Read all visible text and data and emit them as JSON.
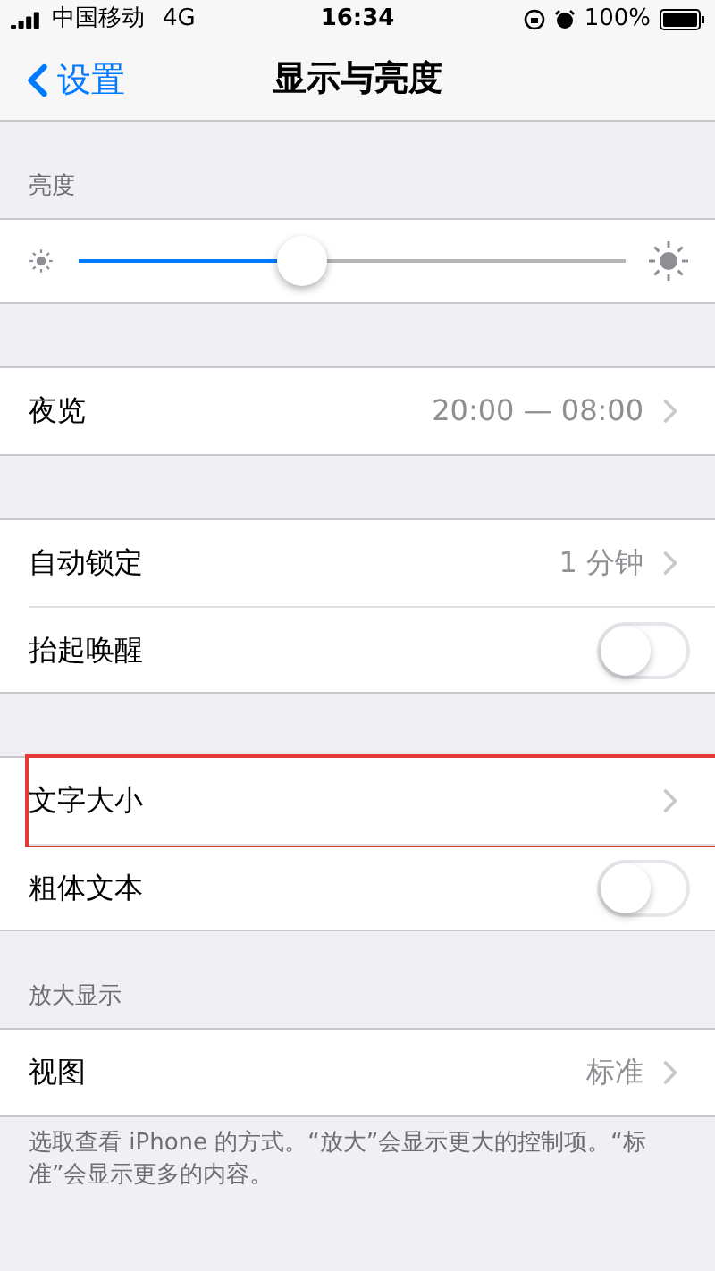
{
  "status_bar": {
    "carrier": "中国移动",
    "network": "4G",
    "time": "16:34",
    "battery": "100%"
  },
  "nav": {
    "back": "设置",
    "title": "显示与亮度"
  },
  "sections": [
    {
      "header": "亮度",
      "kind": "slider",
      "level": 0.41
    },
    {
      "kind": "list",
      "rows": [
        {
          "kind": "value",
          "label": "夜览",
          "value": "20:00 — 08:00",
          "highlighted": false
        }
      ]
    },
    {
      "kind": "list",
      "rows": [
        {
          "kind": "value",
          "label": "自动锁定",
          "value": "1 分钟",
          "highlighted": false
        },
        {
          "kind": "toggle",
          "label": "抬起唤醒",
          "on": false,
          "highlighted": false
        }
      ]
    },
    {
      "kind": "list",
      "rows": [
        {
          "kind": "link",
          "label": "文字大小",
          "highlighted": true
        },
        {
          "kind": "toggle",
          "label": "粗体文本",
          "on": false,
          "highlighted": false
        }
      ]
    },
    {
      "header": "放大显示",
      "kind": "list",
      "rows": [
        {
          "kind": "value",
          "label": "视图",
          "value": "标准",
          "highlighted": false
        }
      ],
      "footer": "选取查看 iPhone 的方式。“放大”会显示更大的控制项。“标准”会显示更多的内容。"
    }
  ]
}
